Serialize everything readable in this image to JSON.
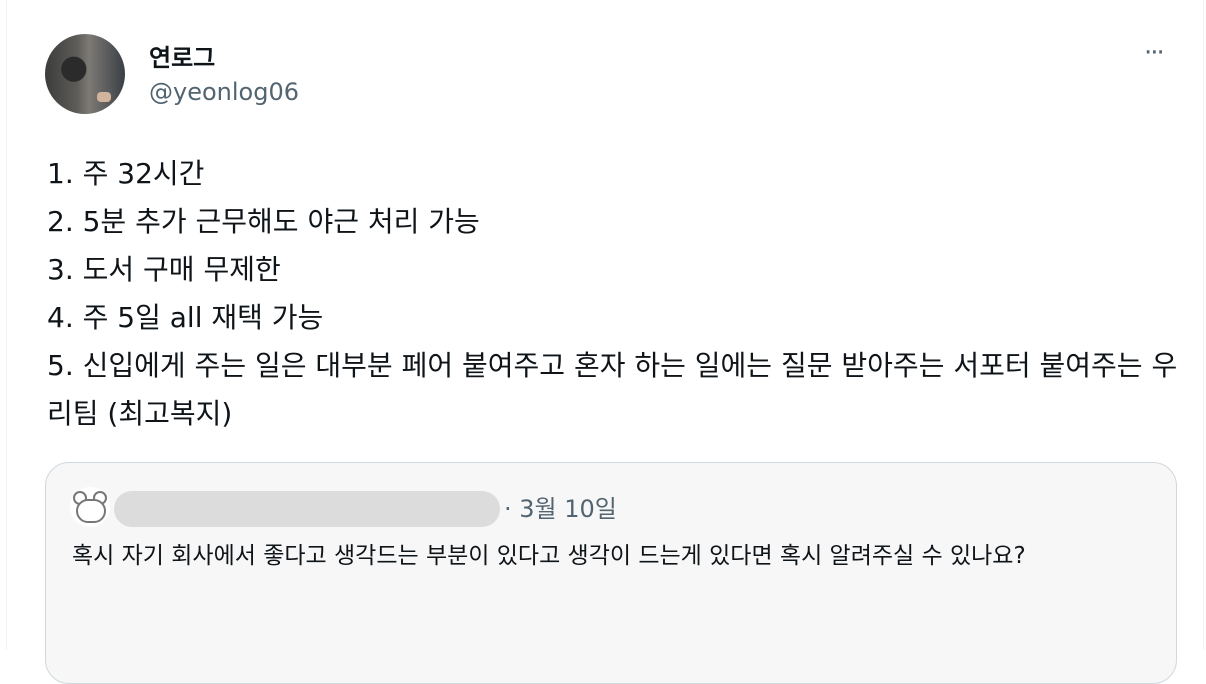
{
  "tweet": {
    "display_name": "연로그",
    "handle": "@yeonlog06",
    "more_icon": "···",
    "lines": [
      "1. 주 32시간",
      "2. 5분 추가 근무해도 야근 처리 가능",
      "3. 도서 구매 무제한",
      "4. 주 5일 all 재택 가능",
      "5. 신입에게 주는 일은 대부분 페어 붙여주고 혼자 하는 일에는 질문 받아주는 서포터 붙여주는 우리팀 (최고복지)"
    ]
  },
  "quoted": {
    "date": "· 3월 10일",
    "text": "혹시 자기 회사에서 좋다고 생각드는 부분이 있다고 생각이 드는게 있다면 혹시 알려주실 수 있나요?"
  },
  "colors": {
    "text": "#0f1419",
    "secondary": "#536471",
    "border": "#cfd9de"
  }
}
